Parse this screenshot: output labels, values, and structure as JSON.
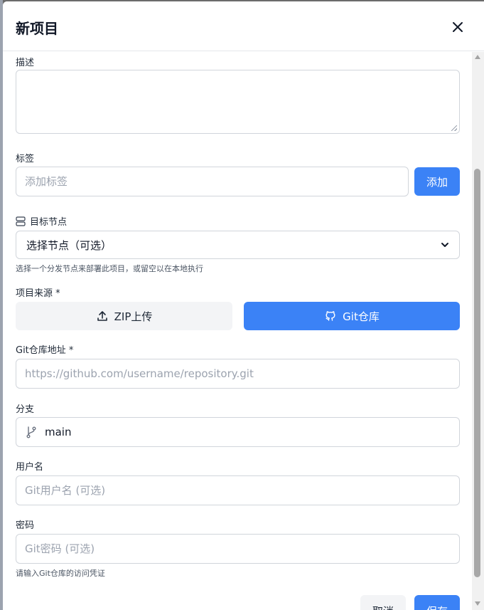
{
  "dialog": {
    "title": "新项目"
  },
  "form": {
    "description_label": "描述",
    "tags_label": "标签",
    "tags_placeholder": "添加标签",
    "add_tag_label": "添加",
    "target_node_label": "目标节点",
    "target_node_selected": "选择节点（可选）",
    "target_node_hint": "选择一个分发节点来部署此项目，或留空以在本地执行",
    "source_label": "项目来源 *",
    "source_zip_label": "ZIP上传",
    "source_git_label": "Git仓库",
    "git_url_label": "Git仓库地址 *",
    "git_url_placeholder": "https://github.com/username/repository.git",
    "branch_label": "分支",
    "branch_value": "main",
    "username_label": "用户名",
    "username_placeholder": "Git用户名 (可选)",
    "password_label": "密码",
    "password_placeholder": "Git密码 (可选)",
    "credentials_hint": "请输入Git仓库的访问凭证"
  },
  "footer": {
    "cancel_label": "取消",
    "save_label": "保存"
  },
  "colors": {
    "primary": "#3b82f6",
    "secondary_button": "#f3f4f6",
    "border": "#d1d5db"
  }
}
